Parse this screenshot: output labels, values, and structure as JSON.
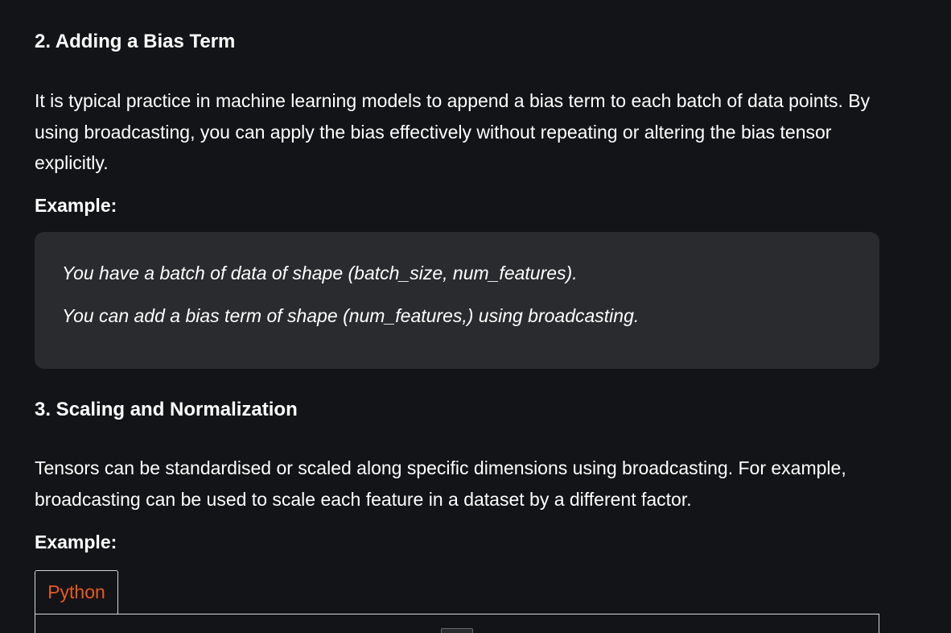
{
  "section2": {
    "heading": "2. Adding a Bias Term",
    "paragraph": "It is typical practice in machine learning models to append a bias term to each batch of data points. By using broadcasting, you can apply the bias effectively without repeating or altering the bias tensor explicitly.",
    "example_label": "Example:",
    "example_lines": [
      "You have a batch of data of shape (batch_size, num_features).",
      "You can add a bias term of shape (num_features,) using broadcasting."
    ]
  },
  "section3": {
    "heading": "3. Scaling and Normalization",
    "paragraph": "Tensors can be standardised or scaled along specific dimensions using broadcasting. For example, broadcasting can be used to scale each feature in a dataset by a different factor.",
    "example_label": "Example:",
    "code_tab_label": "Python"
  },
  "colors": {
    "background": "#131417",
    "example_box": "#2a2b2e",
    "text": "#ffffff",
    "tab_accent": "#e9591f",
    "border": "#d8d8d8"
  }
}
